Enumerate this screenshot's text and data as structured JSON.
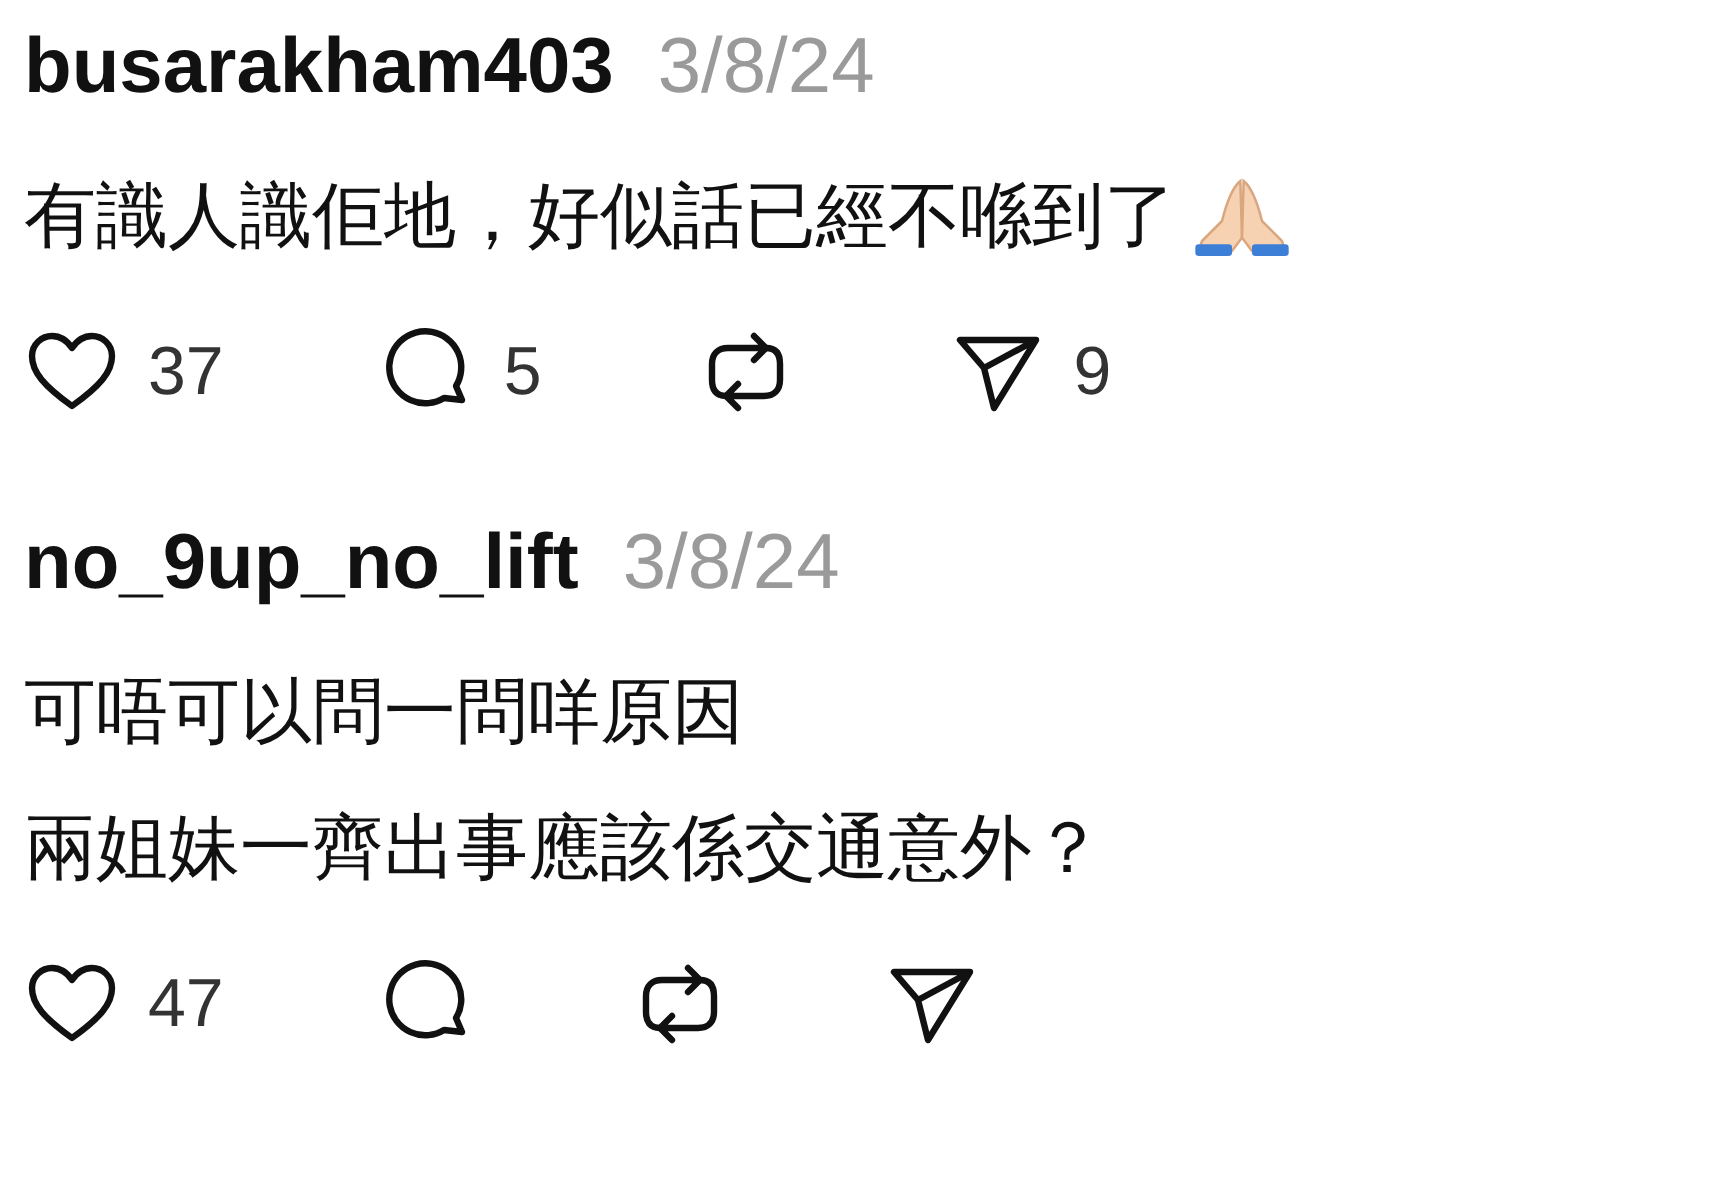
{
  "comments": [
    {
      "username": "busarakham403",
      "date": "3/8/24",
      "lines": [
        "有識人識佢地，好似話已經不喺到了"
      ],
      "trailing_icon": true,
      "actions": [
        {
          "kind": "like",
          "count": "37"
        },
        {
          "kind": "reply",
          "count": "5"
        },
        {
          "kind": "repost"
        },
        {
          "kind": "share",
          "count": "9"
        }
      ]
    },
    {
      "username": "no_9up_no_lift",
      "date": "3/8/24",
      "lines": [
        "可唔可以問一問咩原因",
        "兩姐妹一齊出事應該係交通意外？"
      ],
      "trailing_icon": false,
      "actions": [
        {
          "kind": "like",
          "count": "47"
        },
        {
          "kind": "reply"
        },
        {
          "kind": "repost"
        },
        {
          "kind": "share"
        }
      ]
    }
  ]
}
